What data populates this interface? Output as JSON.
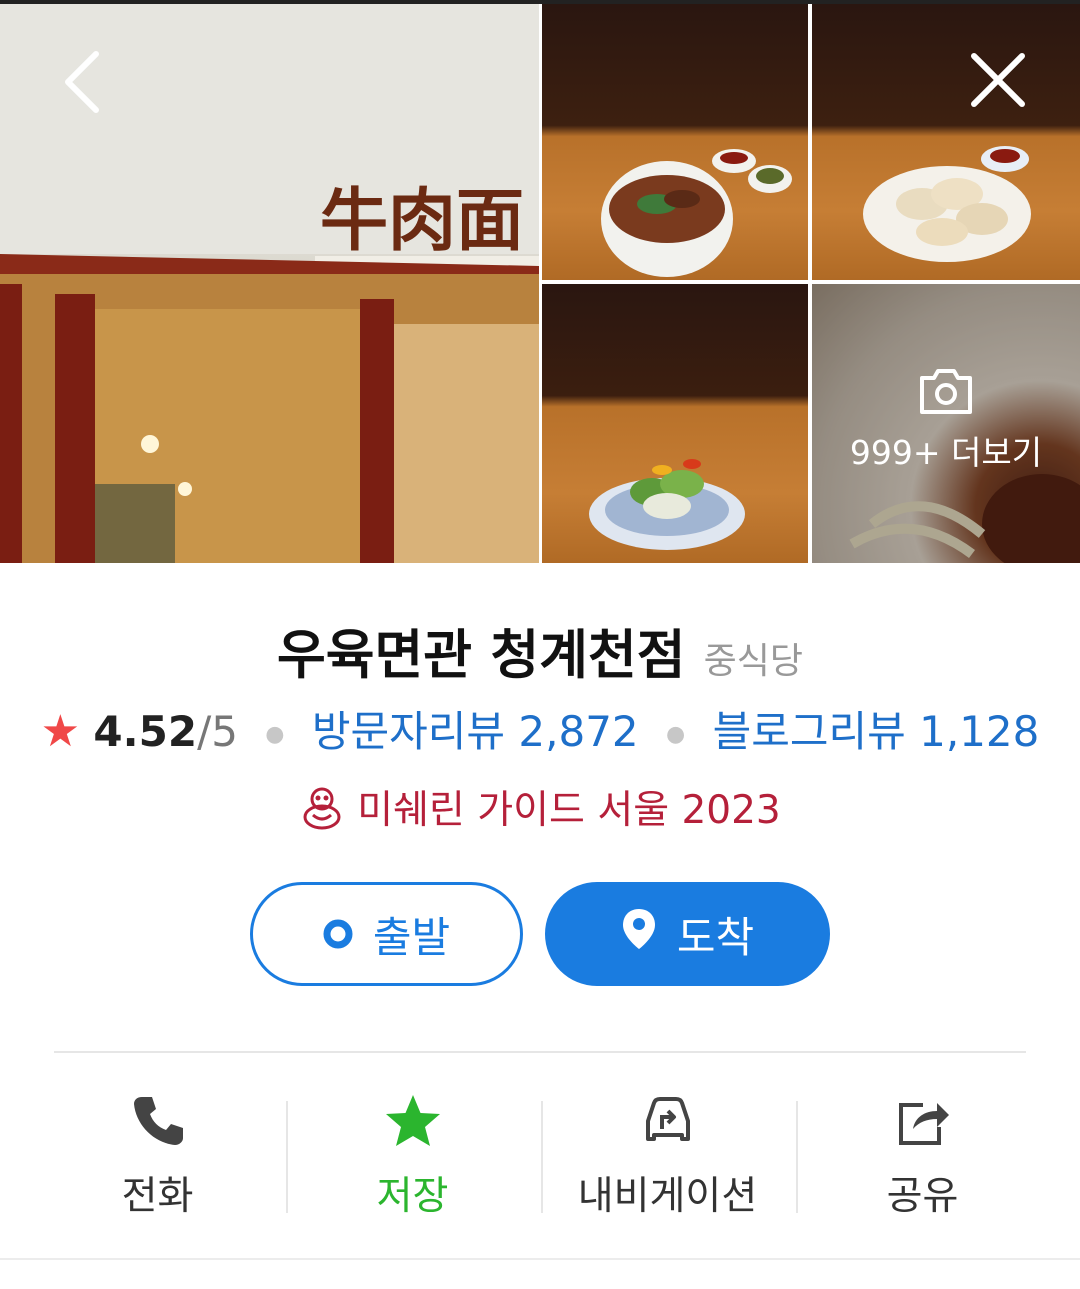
{
  "gallery": {
    "more_label": "999+ 더보기",
    "icons": {
      "back": "chevron-left-icon",
      "close": "close-icon",
      "camera": "camera-icon"
    }
  },
  "place": {
    "name": "우육면관 청계천점",
    "category": "중식당",
    "rating": "4.52",
    "rating_max": "/5",
    "visitor_reviews": "방문자리뷰 2,872",
    "blog_reviews": "블로그리뷰 1,128",
    "michelin": "미쉐린 가이드 서울 2023"
  },
  "route": {
    "depart_label": "출발",
    "arrive_label": "도착"
  },
  "actions": [
    {
      "label": "전화",
      "icon": "phone-icon"
    },
    {
      "label": "저장",
      "icon": "star-icon"
    },
    {
      "label": "내비게이션",
      "icon": "car-navigation-icon"
    },
    {
      "label": "공유",
      "icon": "share-icon"
    }
  ],
  "colors": {
    "accent_blue": "#1a7ce0",
    "link_blue": "#1e6fc9",
    "michelin_red": "#b5203a",
    "rating_star": "#f04848",
    "save_green": "#2bb52e"
  }
}
